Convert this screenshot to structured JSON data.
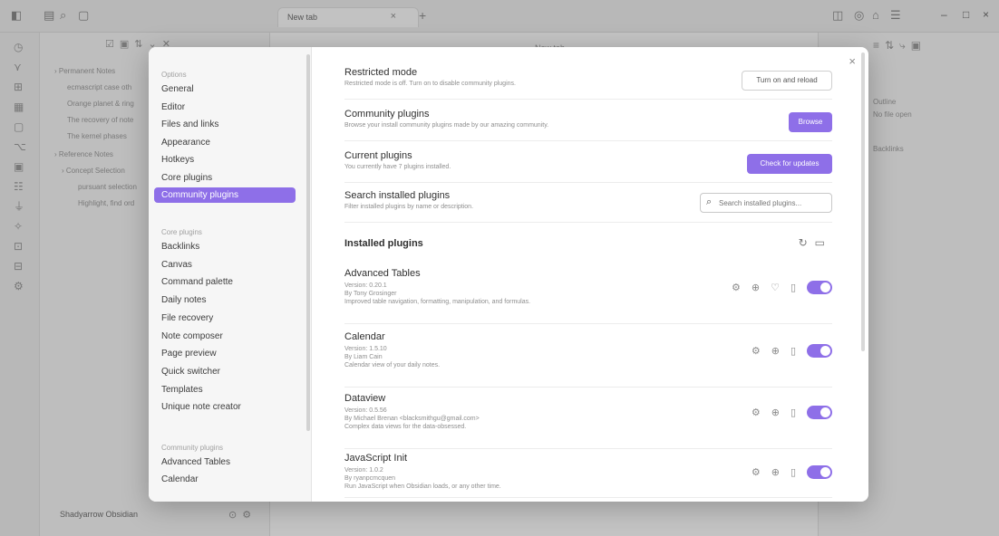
{
  "titlebar": {
    "tab_title": "New tab",
    "tab_close": "×",
    "tab_new": "+",
    "win_min": "–",
    "win_max": "□",
    "win_close": "×"
  },
  "left_pane": {
    "rows": [
      "› Permanent Notes",
      "ecmascript case oth",
      "Orange planet & ring",
      "The recovery of note",
      "The kernel phases",
      "› Reference Notes",
      "› Concept Selection",
      "pursuant selection",
      "Highlight, find ord"
    ],
    "vault_name": "Shadyarrow Obsidian"
  },
  "editor": {
    "title": "New tab"
  },
  "right_pane": {
    "rows": [
      "Outline",
      "No file open",
      "Backlinks"
    ]
  },
  "settings": {
    "sidebar": {
      "options_header": "Options",
      "options": [
        "General",
        "Editor",
        "Files and links",
        "Appearance",
        "Hotkeys",
        "Core plugins",
        "Community plugins"
      ],
      "active_index": 6,
      "core_header": "Core plugins",
      "core": [
        "Backlinks",
        "Canvas",
        "Command palette",
        "Daily notes",
        "File recovery",
        "Note composer",
        "Page preview",
        "Quick switcher",
        "Templates",
        "Unique note creator"
      ],
      "community_header": "Community plugins",
      "community": [
        "Advanced Tables",
        "Calendar"
      ]
    },
    "close": "×",
    "restricted": {
      "name": "Restricted mode",
      "desc": "Restricted mode is off. Turn on to disable community plugins.",
      "button": "Turn on and reload"
    },
    "community": {
      "name": "Community plugins",
      "desc": "Browse your install community plugins made by our amazing community.",
      "button": "Browse"
    },
    "current": {
      "name": "Current plugins",
      "desc": "You currently have 7 plugins installed.",
      "button": "Check for updates"
    },
    "search": {
      "name": "Search installed plugins",
      "desc": "Filter installed plugins by name or description.",
      "placeholder": "Search installed plugins..."
    },
    "installed_title": "Installed plugins",
    "plugins": [
      {
        "name": "Advanced Tables",
        "version": "Version: 0.20.1",
        "author": "By Tony Grosinger",
        "desc": "Improved table navigation, formatting, manipulation, and formulas.",
        "has_heart": true
      },
      {
        "name": "Calendar",
        "version": "Version: 1.5.10",
        "author": "By Liam Cain",
        "desc": "Calendar view of your daily notes.",
        "has_heart": false
      },
      {
        "name": "Dataview",
        "version": "Version: 0.5.56",
        "author": "By Michael Brenan <blacksmithgu@gmail.com>",
        "desc": "Complex data views for the data-obsessed.",
        "has_heart": false
      },
      {
        "name": "JavaScript Init",
        "version": "Version: 1.0.2",
        "author": "By ryanpcmcquen",
        "desc": "Run JavaScript when Obsidian loads, or any other time.",
        "has_heart": false
      }
    ],
    "icons": {
      "reload": "↻",
      "folder": "🗀",
      "gear": "⚙",
      "plus": "⊕",
      "heart": "♡",
      "trash": "🗑",
      "search": "🔍"
    },
    "accent": "#8e6fe8"
  }
}
